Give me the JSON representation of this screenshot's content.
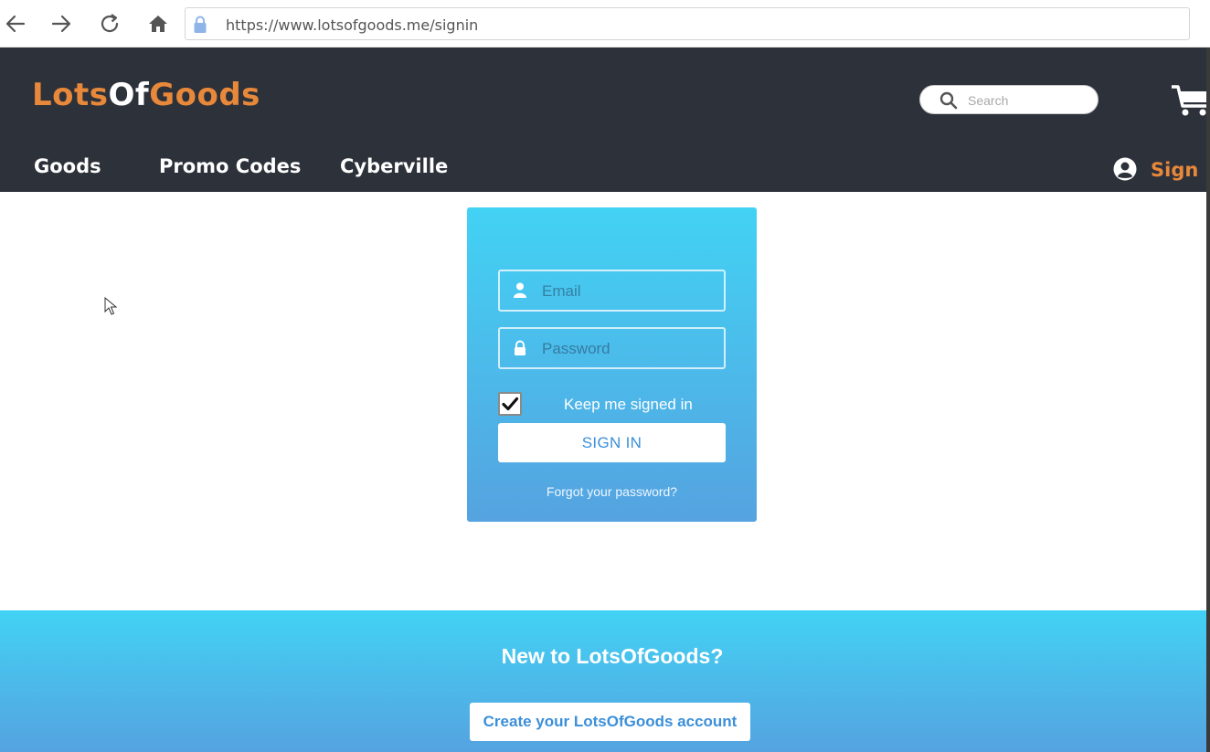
{
  "browser": {
    "url": "https://www.lotsofgoods.me/signin"
  },
  "header": {
    "logo": {
      "part1": "Lots",
      "part2": "Of",
      "part3": "Goods"
    },
    "search_placeholder": "Search",
    "nav": [
      {
        "label": "Goods"
      },
      {
        "label": "Promo Codes"
      },
      {
        "label": "Cyberville"
      }
    ],
    "signin_label": "Sign in"
  },
  "login": {
    "email_placeholder": "Email",
    "password_placeholder": "Password",
    "keep_signed_in_label": "Keep me signed in",
    "keep_signed_in_checked": true,
    "signin_button": "SIGN IN",
    "forgot_link": "Forgot your password?"
  },
  "banner": {
    "title": "New to LotsOfGoods?",
    "create_button": "Create your LotsOfGoods account"
  },
  "colors": {
    "header_bg": "#2d313a",
    "accent_orange": "#e8883a",
    "gradient_top": "#42d2f4",
    "gradient_bottom": "#55a3e0",
    "button_text": "#3b8fd9"
  }
}
